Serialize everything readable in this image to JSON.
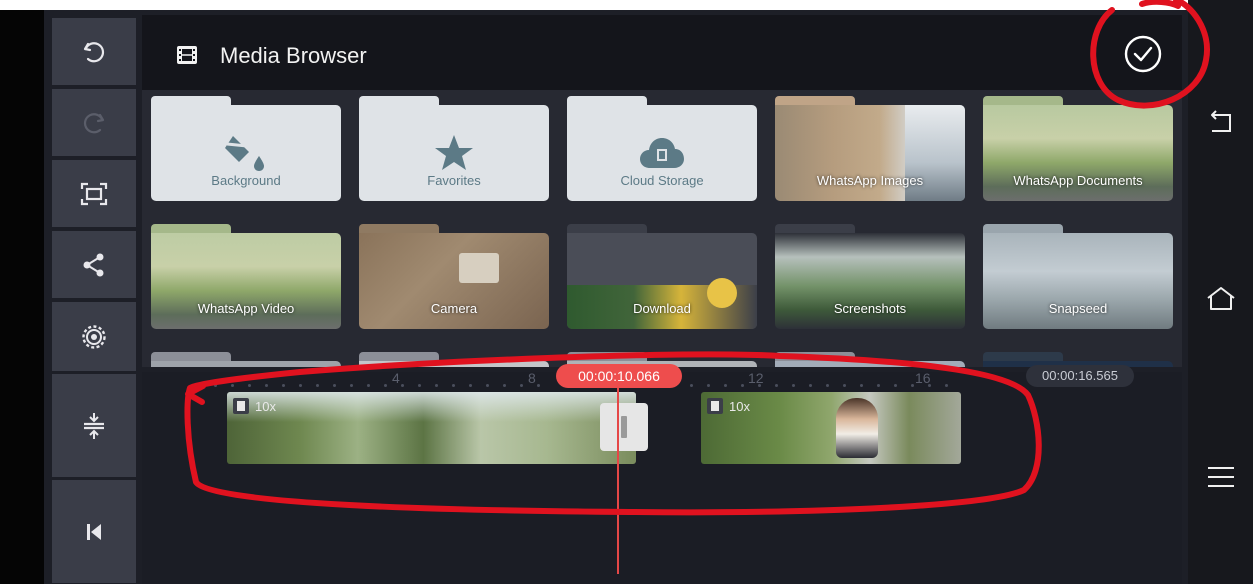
{
  "media_browser": {
    "title": "Media Browser",
    "folders_row1": [
      {
        "label": "Background",
        "kind": "folder-light",
        "icon": "paint-bucket-icon"
      },
      {
        "label": "Favorites",
        "kind": "folder-light",
        "icon": "star-icon"
      },
      {
        "label": "Cloud Storage",
        "kind": "folder-light",
        "icon": "cloud-icon"
      },
      {
        "label": "WhatsApp Images",
        "kind": "thumbnail"
      },
      {
        "label": "WhatsApp Documents",
        "kind": "thumbnail"
      }
    ],
    "folders_row2": [
      {
        "label": "WhatsApp Video",
        "kind": "thumbnail"
      },
      {
        "label": "Camera",
        "kind": "thumbnail"
      },
      {
        "label": "Download",
        "kind": "thumbnail"
      },
      {
        "label": "Screenshots",
        "kind": "thumbnail"
      },
      {
        "label": "Snapseed",
        "kind": "thumbnail"
      }
    ]
  },
  "timeline": {
    "ruler_labels": [
      "4",
      "8",
      "12",
      "16"
    ],
    "playhead_time": "00:00:10.066",
    "total_time": "00:00:16.565",
    "clips": [
      {
        "speed": "10x"
      },
      {
        "speed": "10x"
      }
    ]
  },
  "left_toolbar": {
    "icons": [
      "undo-icon",
      "redo-icon",
      "fullscreen-icon",
      "share-icon",
      "settings-icon",
      "split-icon",
      "jump-to-start-icon"
    ]
  },
  "right_nav": {
    "icons": [
      "back-icon",
      "home-icon",
      "menu-icon"
    ]
  },
  "colors": {
    "accent_red": "#ee4d4d",
    "panel": "#3a3d48",
    "background": "#1d1f27",
    "annotation": "#e0121f"
  }
}
